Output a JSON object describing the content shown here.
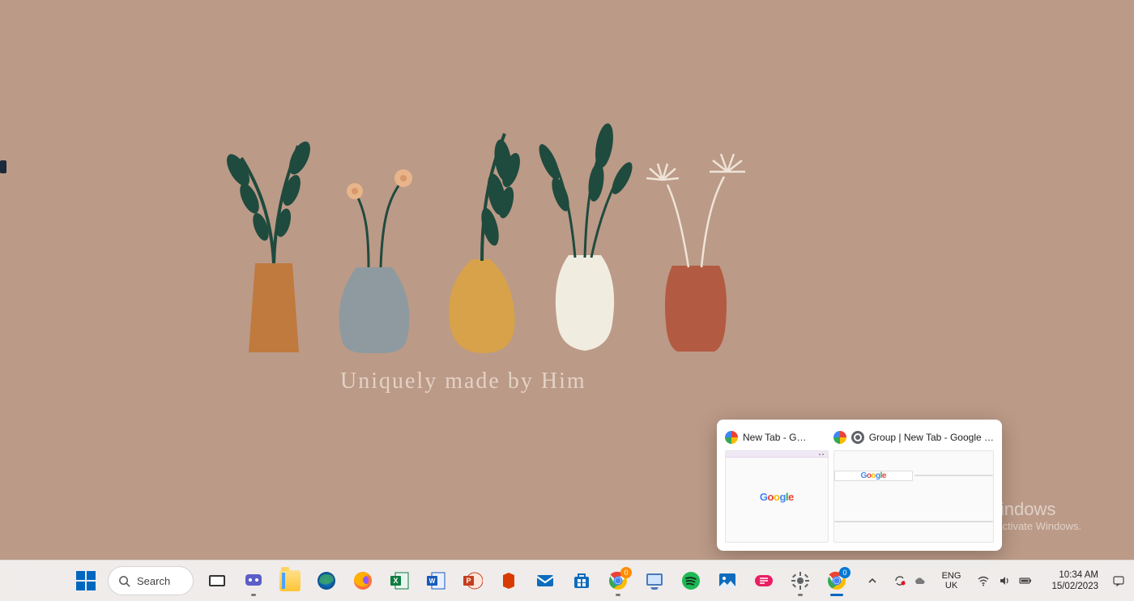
{
  "wallpaper": {
    "caption": "Uniquely made by Him"
  },
  "activation": {
    "title": "Activate Windows",
    "subtitle": "Go to Settings to activate Windows."
  },
  "preview": {
    "items": [
      {
        "title": "New Tab - G…"
      },
      {
        "title": "Group | New Tab - Google …"
      }
    ]
  },
  "taskbar": {
    "search_label": "Search",
    "apps": [
      {
        "name": "start",
        "tooltip": "Start"
      },
      {
        "name": "task-view",
        "tooltip": "Task View"
      },
      {
        "name": "teams-chat",
        "tooltip": "Chat"
      },
      {
        "name": "file-explorer",
        "tooltip": "File Explorer"
      },
      {
        "name": "edge",
        "tooltip": "Microsoft Edge"
      },
      {
        "name": "firefox",
        "tooltip": "Firefox"
      },
      {
        "name": "excel",
        "tooltip": "Excel"
      },
      {
        "name": "word",
        "tooltip": "Word"
      },
      {
        "name": "powerpoint",
        "tooltip": "PowerPoint"
      },
      {
        "name": "office",
        "tooltip": "Microsoft 365"
      },
      {
        "name": "mail",
        "tooltip": "Mail"
      },
      {
        "name": "microsoft-store",
        "tooltip": "Microsoft Store"
      },
      {
        "name": "chrome",
        "tooltip": "Google Chrome",
        "badge": "0"
      },
      {
        "name": "paint",
        "tooltip": "Paint"
      },
      {
        "name": "spotify",
        "tooltip": "Spotify"
      },
      {
        "name": "photos",
        "tooltip": "Photos"
      },
      {
        "name": "pinned-app-1",
        "tooltip": "App"
      },
      {
        "name": "settings",
        "tooltip": "Settings"
      },
      {
        "name": "chrome-2",
        "tooltip": "Google Chrome",
        "badge": "0",
        "badge_color": "blue",
        "active": true
      }
    ]
  },
  "tray": {
    "lang_line1": "ENG",
    "lang_line2": "UK",
    "time": "10:34 AM",
    "date": "15/02/2023"
  }
}
